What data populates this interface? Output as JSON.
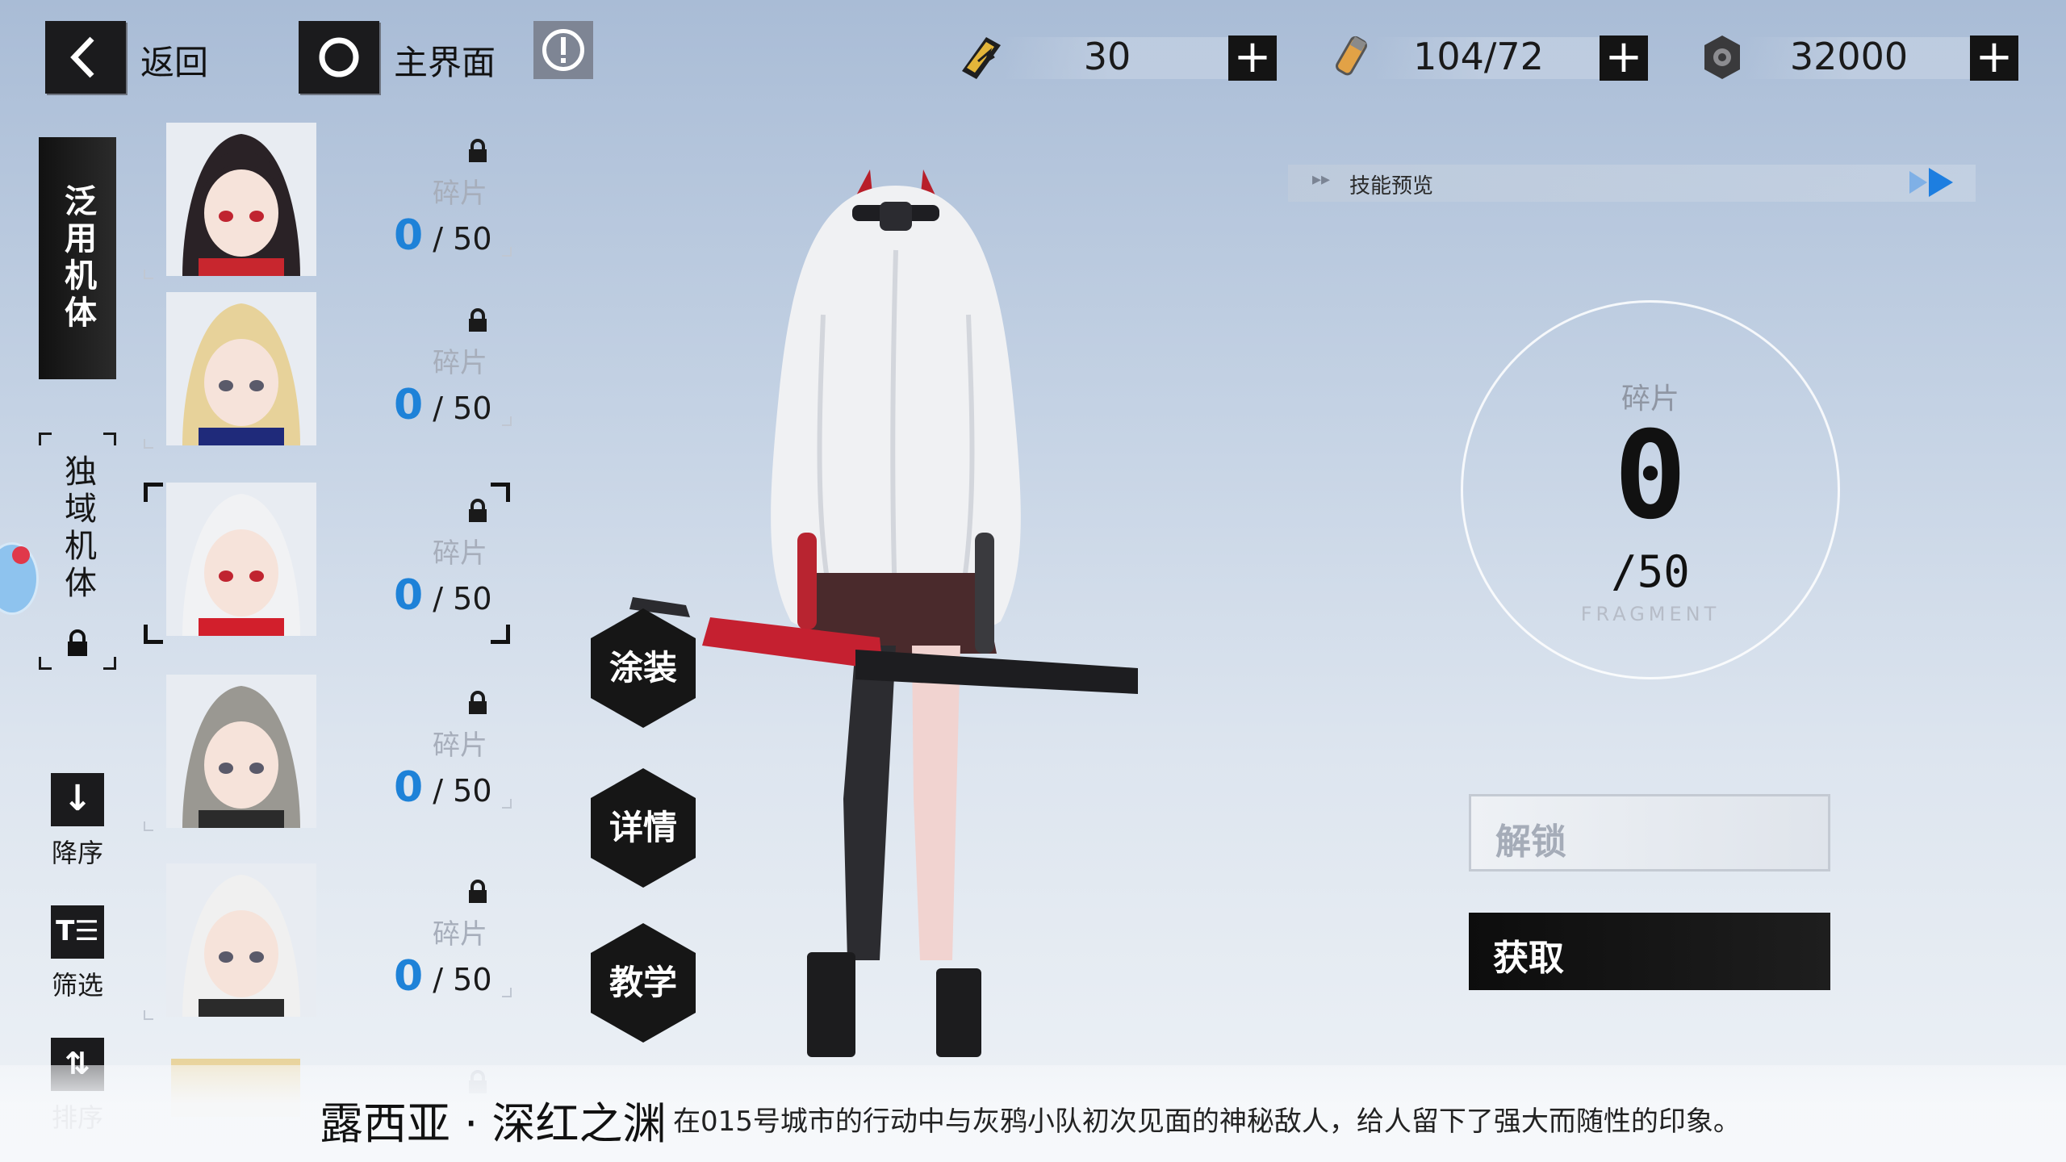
{
  "topbar": {
    "back_label": "返回",
    "home_label": "主界面"
  },
  "resources": [
    {
      "icon": "card-ticket-icon",
      "value": "30"
    },
    {
      "icon": "energy-vial-icon",
      "value": "104/72"
    },
    {
      "icon": "gear-coin-icon",
      "value": "32000"
    }
  ],
  "categories": {
    "active": "泛用机体",
    "inactive": "独域机体"
  },
  "side_buttons": {
    "sort_desc": "降序",
    "filter": "筛选",
    "sort": "排序"
  },
  "roster": [
    {
      "frag_label": "碎片",
      "current": "0",
      "total": "/ 50",
      "hair": "#2a2226",
      "accent": "#c8262e"
    },
    {
      "frag_label": "碎片",
      "current": "0",
      "total": "/ 50",
      "hair": "#e7d29a",
      "accent": "#1f2a7a"
    },
    {
      "frag_label": "碎片",
      "current": "0",
      "total": "/ 50",
      "hair": "#f1f2f4",
      "accent": "#d21f2c"
    },
    {
      "frag_label": "碎片",
      "current": "0",
      "total": "/ 50",
      "hair": "#9a9892",
      "accent": "#2b2b2b"
    },
    {
      "frag_label": "碎片",
      "current": "0",
      "total": "/ 50",
      "hair": "#f0f0f0",
      "accent": "#2b2b2b"
    }
  ],
  "actions": {
    "skin": "涂装",
    "details": "详情",
    "tutorial": "教学"
  },
  "skill_preview": "技能预览",
  "fragment": {
    "label": "碎片",
    "current": "0",
    "total": "/50",
    "english": "FRAGMENT"
  },
  "buttons": {
    "unlock": "解锁",
    "obtain": "获取"
  },
  "character": {
    "name": "露西亚 · 深红之渊",
    "description": "在015号城市的行动中与灰鸦小队初次见面的神秘敌人，给人留下了强大而随性的印象。"
  },
  "colors": {
    "accent_blue": "#1e82d8",
    "dark": "#161616"
  }
}
